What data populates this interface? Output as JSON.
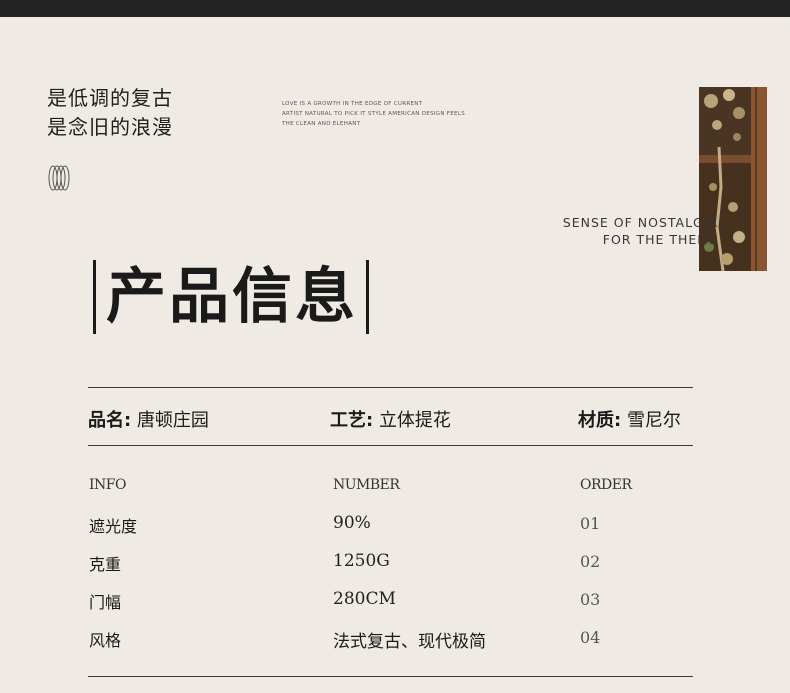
{
  "slogan": {
    "line1": "是低调的复古",
    "line2": "是念旧的浪漫"
  },
  "tagline": {
    "line1": "LOVE IS A GROWTH IN THE EDGE OF CURRENT",
    "line2": "ARTIST NATURAL TO PICK IT STYLE AMERICAN DESIGN FEELS",
    "line3": "THE CLEAN AND ELEHANT"
  },
  "nostalgia": {
    "line1": "SENSE OF NOSTALGIA",
    "line2": "FOR THE THEME"
  },
  "heading": {
    "title": "产品信息"
  },
  "specs": {
    "name_label": "品名:",
    "name_value": "唐顿庄园",
    "craft_label": "工艺:",
    "craft_value": "立体提花",
    "material_label": "材质:",
    "material_value": "雪尼尔"
  },
  "table": {
    "headers": [
      "INFO",
      "NUMBER",
      "ORDER"
    ],
    "rows": [
      {
        "info": "遮光度",
        "number": "90%",
        "order": "01"
      },
      {
        "info": "克重",
        "number": "1250G",
        "order": "02"
      },
      {
        "info": "门幅",
        "number": "280CM",
        "order": "03"
      },
      {
        "info": "风格",
        "number": "法式复古、现代极简",
        "order": "04"
      }
    ]
  },
  "colors": {
    "background": "#efebe4",
    "topbar": "#242424",
    "text": "#1a1a1a"
  }
}
